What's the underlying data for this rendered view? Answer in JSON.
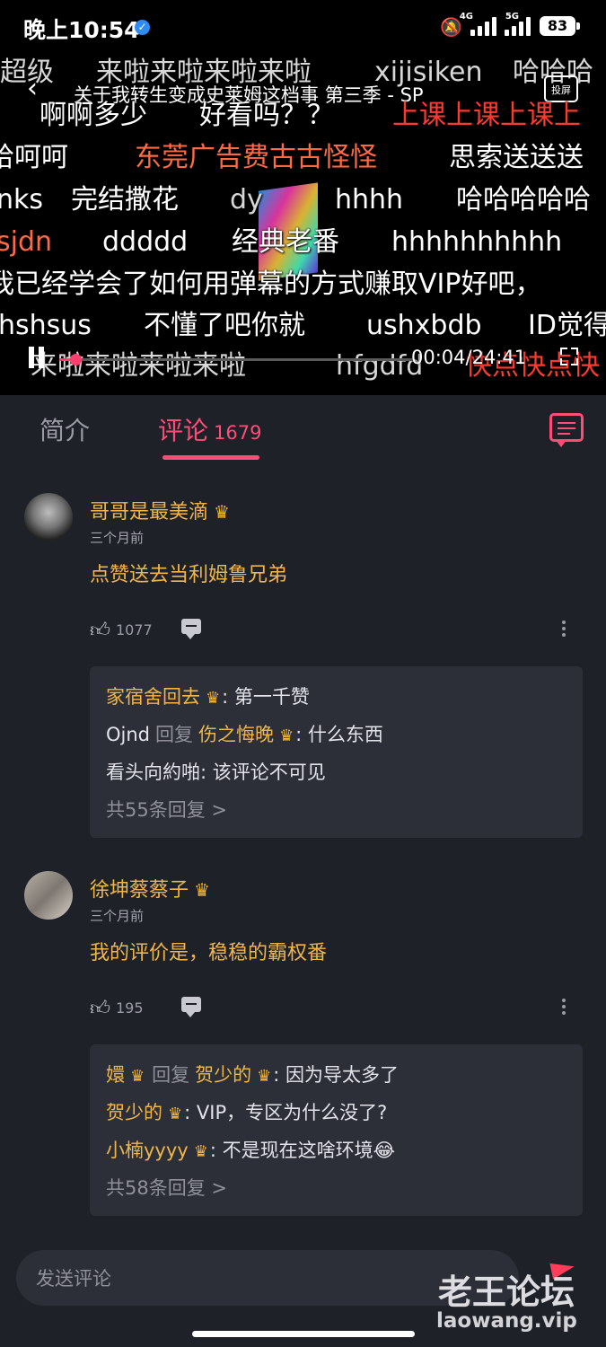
{
  "status_bar": {
    "time": "晚上10:54",
    "network_1": "4G",
    "network_2": "5G",
    "battery": "83"
  },
  "video": {
    "title": "关于我转生变成史莱姆这档事 第三季 - SP",
    "cast_label": "投屏",
    "current_time": "00:04",
    "duration": "24:41",
    "time_display": "00:04/24:41",
    "progress_fraction": 0.003,
    "danmaku": [
      {
        "text": "超级",
        "color": "dim"
      },
      {
        "text": "来啦来啦来啦来啦",
        "color": "dim"
      },
      {
        "text": "xijisiken",
        "color": "dim"
      },
      {
        "text": "哈哈哈",
        "color": "dim"
      },
      {
        "text": "啊啊多少",
        "color": "white"
      },
      {
        "text": "好看吗？？",
        "color": "white"
      },
      {
        "text": "上课上课上课上",
        "color": "red"
      },
      {
        "text": "哈呵呵",
        "color": "white"
      },
      {
        "text": "东莞广告费古古怪怪",
        "color": "orange"
      },
      {
        "text": "思索送送送",
        "color": "white"
      },
      {
        "text": "nks",
        "color": "white"
      },
      {
        "text": "完结撒花",
        "color": "white"
      },
      {
        "text": "dy",
        "color": "dim"
      },
      {
        "text": "hhhh",
        "color": "white"
      },
      {
        "text": "哈哈哈哈哈",
        "color": "white"
      },
      {
        "text": "sjdn",
        "color": "orange"
      },
      {
        "text": "ddddd",
        "color": "white"
      },
      {
        "text": "经典老番",
        "color": "white"
      },
      {
        "text": "hhhhhhhhhh",
        "color": "white"
      },
      {
        "text": "我已经学会了如何用弹幕的方式赚取VIP好吧，",
        "color": "white"
      },
      {
        "text": "hshsus",
        "color": "white"
      },
      {
        "text": "不懂了吧你就",
        "color": "white"
      },
      {
        "text": "ushxbdb",
        "color": "white"
      },
      {
        "text": "ID觉得",
        "color": "white"
      },
      {
        "text": "来啦来啦来啦来啦",
        "color": "dim"
      },
      {
        "text": "hfgdfd",
        "color": "dim"
      },
      {
        "text": "快点快点快",
        "color": "red"
      }
    ]
  },
  "tabs": {
    "intro": "简介",
    "comments": "评论",
    "comments_count": "1679"
  },
  "comments": [
    {
      "user": "哥哥是最美滴",
      "time": "三个月前",
      "text": "点赞送去当利姆鲁兄弟",
      "likes": "1077",
      "replies": [
        {
          "name": "家宿舍回去",
          "crown": true,
          "text": ": 第一千赞"
        },
        {
          "name": "Ojnd",
          "verb": "回复",
          "target": "伤之悔晚",
          "target_crown": true,
          "text": ": 什么东西"
        },
        {
          "name": "看头向約啪",
          "text": ": 该评论不可见"
        }
      ],
      "more": "共55条回复 >"
    },
    {
      "user": "徐坤蔡蔡子",
      "time": "三个月前",
      "text": "我的评价是，稳稳的霸权番",
      "likes": "195",
      "replies": [
        {
          "name": "嬛",
          "crown": true,
          "verb": "回复",
          "target": "贺少的",
          "target_crown": true,
          "text": ": 因为导太多了"
        },
        {
          "name": "贺少的",
          "crown": true,
          "text": ": VIP，专区为什么没了?"
        },
        {
          "name": "小楠yyyy",
          "crown": true,
          "text": ": 不是现在这啥环境😂"
        }
      ],
      "more": "共58条回复 >"
    }
  ],
  "input": {
    "placeholder": "发送评论"
  },
  "watermark": {
    "title": "老王论坛",
    "url": "laowang.vip"
  },
  "icons": {
    "crown": "crown-icon",
    "thumb": "thumbs-up-icon",
    "reply": "reply-icon",
    "more": "more-vertical-icon"
  },
  "colors": {
    "accent": "#ff4d78",
    "gold": "#f0b64a",
    "background": "#1f2129"
  }
}
